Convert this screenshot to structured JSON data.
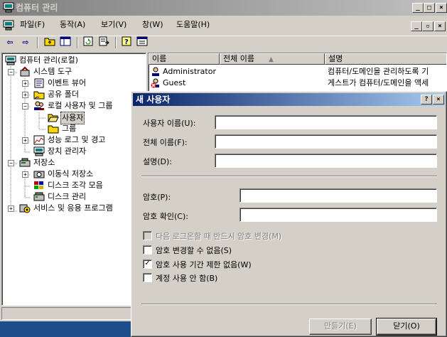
{
  "window": {
    "title": "컴퓨터 관리",
    "min_glyph": "_",
    "max_glyph": "□",
    "close_glyph": "×",
    "restore_glyph": "▫"
  },
  "menu": {
    "items": [
      "파일(F)",
      "동작(A)",
      "보기(V)",
      "창(W)",
      "도움말(H)"
    ]
  },
  "toolbar": {
    "back_glyph": "⇦",
    "forward_glyph": "⇨"
  },
  "tree": {
    "root": "컴퓨터 관리(로컬)",
    "system_tools": "시스템 도구",
    "event_viewer": "이벤트 뷰어",
    "shared_folders": "공유 폴더",
    "local_users_groups": "로컬 사용자 및 그룹",
    "users": "사용자",
    "groups": "그룹",
    "perf_logs": "성능 로그 및 경고",
    "device_manager": "장치 관리자",
    "storage": "저장소",
    "removable_storage": "이동식 저장소",
    "defrag": "디스크 조각 모음",
    "disk_mgmt": "디스크 관리",
    "services_apps": "서비스 및 응용 프로그램"
  },
  "list": {
    "columns": [
      "이름",
      "전체 이름",
      "설명"
    ],
    "rows": [
      {
        "name": "Administrator",
        "full_name": "",
        "description": "컴퓨터/도메인을 관리하도록 기"
      },
      {
        "name": "Guest",
        "full_name": "",
        "description": "게스트가 컴퓨터/도메인을 액세"
      }
    ]
  },
  "dialog": {
    "title": "새 사용자",
    "help_glyph": "?",
    "close_glyph": "×",
    "username_label": "사용자 이름(U):",
    "fullname_label": "전체 이름(F):",
    "description_label": "설명(D):",
    "password_label": "암호(P):",
    "confirm_label": "암호 확인(C):",
    "username_value": "",
    "fullname_value": "",
    "description_value": "",
    "password_value": "",
    "confirm_value": "",
    "chk_change_next_logon": "다음 로그온할 때 반드시 암호 변경(M)",
    "chk_cannot_change": "암호 변경할 수 없음(S)",
    "chk_never_expires": "암호 사용 기간 제한 없음(W)",
    "chk_disabled": "계정 사용 안 함(B)",
    "check_glyph": "✓",
    "create_button": "만들기(E)",
    "close_button": "닫기(O)"
  }
}
